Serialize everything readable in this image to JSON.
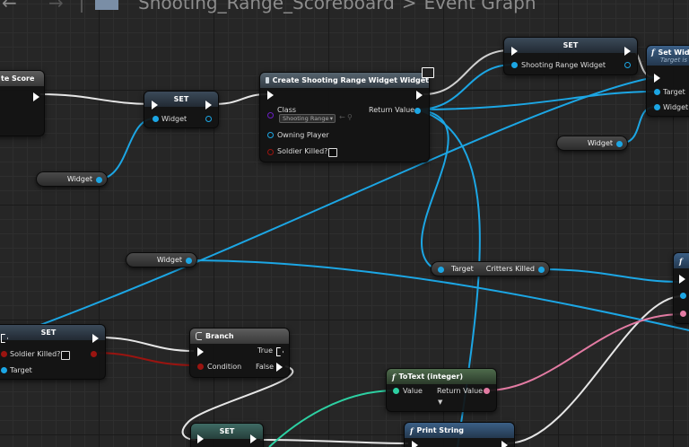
{
  "breadcrumb": {
    "blueprint": "Shooting_Range_Scoreboard",
    "separator": ">",
    "graph": "Event Graph"
  },
  "nodes": {
    "partial_left_title": "te Score",
    "set_widget": {
      "title": "SET",
      "pin": "Widget"
    },
    "widget_var_1": "Widget",
    "create_widget": {
      "title": "Create Shooting Range Widget Widget",
      "class_label": "Class",
      "class_value": "Shooting Range",
      "return_label": "Return Value",
      "owning_player": "Owning Player",
      "soldier_killed": "Soldier Killed?"
    },
    "set_shooting": {
      "title": "SET",
      "pin": "Shooting Range Widget"
    },
    "set_widget_fn": {
      "title": "Set Widg",
      "subtitle": "Target is",
      "target": "Target",
      "widget": "Widget"
    },
    "widget_var_2": "Widget",
    "widget_var_3": "Widget",
    "critters": {
      "target": "Target",
      "output": "Critters Killed"
    },
    "set_soldier": {
      "title": "SET",
      "soldier": "Soldier Killed?",
      "target": "Target"
    },
    "branch": {
      "title": "Branch",
      "true": "True",
      "false": "False",
      "condition": "Condition"
    },
    "totext": {
      "title": "ToText (integer)",
      "value": "Value",
      "return": "Return Value"
    },
    "set_bottom": {
      "title": "SET"
    },
    "print_string": {
      "title": "Print String"
    }
  },
  "colors": {
    "object_pin": "#1ca6e4",
    "bool_pin": "#9a1410",
    "text_pin": "#e37ba3",
    "int_pin": "#2dd0a2",
    "exec_wire": "#ffffff"
  }
}
